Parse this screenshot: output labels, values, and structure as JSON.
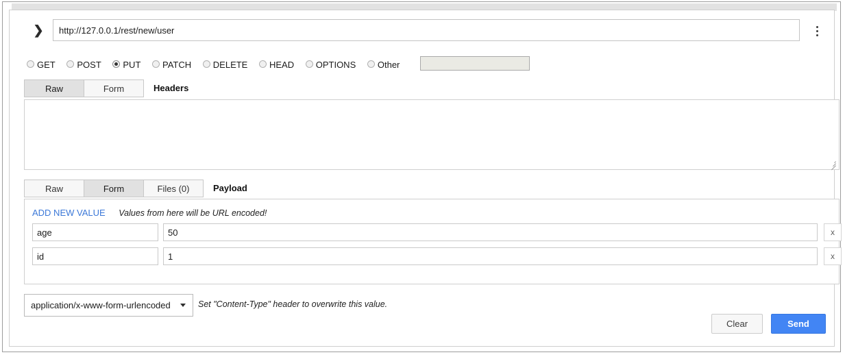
{
  "url_bar": {
    "expand_icon": "chevron-right-icon",
    "value": "http://127.0.0.1/rest/new/user",
    "placeholder": "",
    "menu_icon": "overflow-menu-icon"
  },
  "methods": {
    "selected": "PUT",
    "options": [
      "GET",
      "POST",
      "PUT",
      "PATCH",
      "DELETE",
      "HEAD",
      "OPTIONS",
      "Other"
    ],
    "other_value": "",
    "other_placeholder": ""
  },
  "headers_section": {
    "title": "Headers",
    "tabs": [
      {
        "label": "Raw",
        "active": true
      },
      {
        "label": "Form",
        "active": false
      }
    ],
    "textarea_value": "",
    "textarea_placeholder": ""
  },
  "payload_section": {
    "title": "Payload",
    "tabs": [
      {
        "label": "Raw",
        "active": false
      },
      {
        "label": "Form",
        "active": true
      },
      {
        "label": "Files (0)",
        "active": false
      }
    ],
    "add_new_value_label": "ADD NEW VALUE",
    "url_encoded_note": "Values from here will be URL encoded!",
    "delete_label": "x",
    "rows": [
      {
        "key": "age",
        "value": "50"
      },
      {
        "key": "id",
        "value": "1"
      }
    ]
  },
  "content_type": {
    "selected": "application/x-www-form-urlencoded",
    "options": [
      "application/x-www-form-urlencoded"
    ],
    "note": "Set \"Content-Type\" header to overwrite this value."
  },
  "actions": {
    "clear_label": "Clear",
    "send_label": "Send",
    "send_color": "#4285f4"
  }
}
